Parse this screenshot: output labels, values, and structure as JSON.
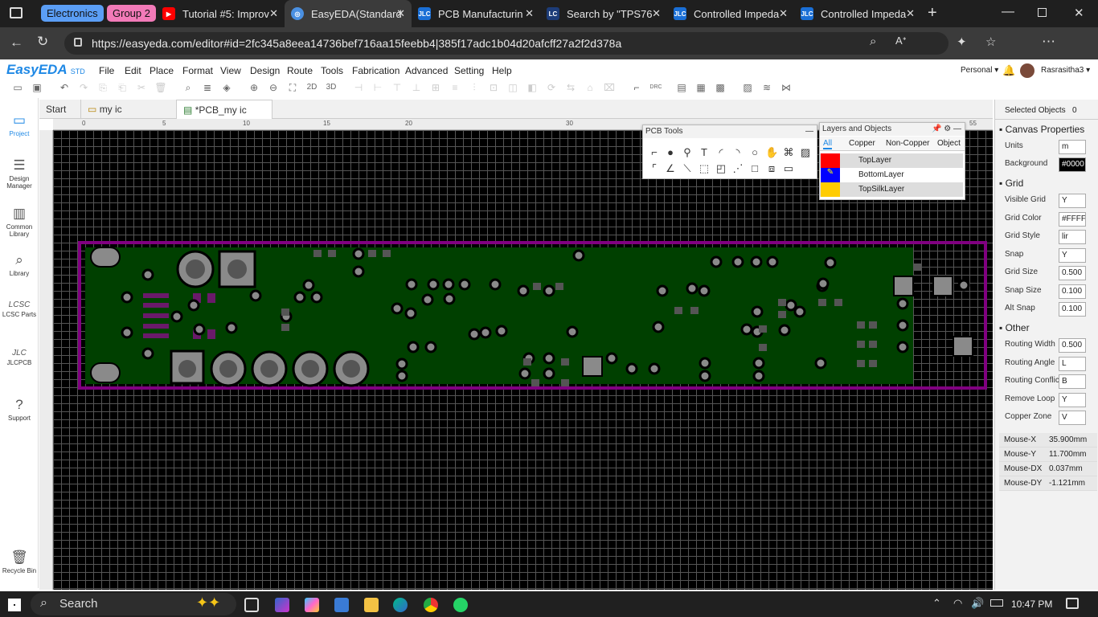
{
  "browser": {
    "tab_groups": [
      {
        "label": "Electronics",
        "color": "#5b9ef5"
      },
      {
        "label": "Group 2",
        "color": "#f27ab8"
      }
    ],
    "tabs": [
      {
        "title": "Tutorial #5: Improv",
        "icon": "youtube-icon",
        "active": false
      },
      {
        "title": "EasyEDA(Standard",
        "icon": "easyeda-icon",
        "active": true
      },
      {
        "title": "PCB Manufacturin",
        "icon": "jlc-icon",
        "active": false
      },
      {
        "title": "Search by \"TPS76",
        "icon": "lcsc-icon",
        "active": false
      },
      {
        "title": "Controlled Impeda",
        "icon": "jlc-icon",
        "active": false
      },
      {
        "title": "Controlled Impeda",
        "icon": "jlc-icon",
        "active": false
      }
    ],
    "url": "https://easyeda.com/editor#id=2fc345a8eea14736bef716aa15feebb4|385f17adc1b04d20afcff27a2f2d378a"
  },
  "app": {
    "logo": "EasyEDA",
    "logo_suffix": "STD",
    "menu": [
      "File",
      "Edit",
      "Place",
      "Format",
      "View",
      "Design",
      "Route",
      "Tools",
      "Fabrication",
      "Advanced",
      "Setting",
      "Help"
    ],
    "account": "Personal",
    "user": "Rasrasitha3",
    "toolbar_labels": {
      "two_d": "2D",
      "three_d": "3D",
      "drc": "DRC"
    }
  },
  "sidebar": [
    {
      "label": "Project",
      "icon": "folder-icon"
    },
    {
      "label": "Design Manager",
      "icon": "list-icon"
    },
    {
      "label": "Common Library",
      "icon": "chip-icon"
    },
    {
      "label": "Library",
      "icon": "search-icon"
    },
    {
      "label": "LCSC Parts",
      "icon": "lcsc-icon"
    },
    {
      "label": "JLCPCB",
      "icon": "jlc-icon"
    },
    {
      "label": "Support",
      "icon": "help-icon"
    },
    {
      "label": "Recycle Bin",
      "icon": "trash-icon"
    }
  ],
  "doc_tabs": [
    {
      "label": "Start"
    },
    {
      "label": "my ic"
    },
    {
      "label": "*PCB_my ic"
    }
  ],
  "ruler_ticks": [
    "0",
    "5",
    "10",
    "15",
    "20",
    "30",
    "55"
  ],
  "pcb_tools": {
    "title": "PCB Tools"
  },
  "layers": {
    "title": "Layers and Objects",
    "tabs": [
      "All",
      "Copper",
      "Non-Copper",
      "Object"
    ],
    "items": [
      {
        "name": "TopLayer",
        "color": "#ff0000"
      },
      {
        "name": "BottomLayer",
        "color": "#0000ff"
      },
      {
        "name": "TopSilkLayer",
        "color": "#ffcc00"
      }
    ]
  },
  "properties": {
    "selected_label": "Selected Objects",
    "selected_count": "0",
    "canvas_title": "Canvas Properties",
    "units_label": "Units",
    "units_value": "m",
    "background_label": "Background",
    "background_value": "#0000",
    "grid_title": "Grid",
    "visible_grid_label": "Visible Grid",
    "visible_grid_value": "Y",
    "grid_color_label": "Grid Color",
    "grid_color_value": "#FFFF",
    "grid_style_label": "Grid Style",
    "grid_style_value": "lir",
    "snap_label": "Snap",
    "snap_value": "Y",
    "grid_size_label": "Grid Size",
    "grid_size_value": "0.500",
    "snap_size_label": "Snap Size",
    "snap_size_value": "0.100",
    "alt_snap_label": "Alt Snap",
    "alt_snap_value": "0.100",
    "other_title": "Other",
    "routing_width_label": "Routing Width",
    "routing_width_value": "0.500",
    "routing_angle_label": "Routing Angle",
    "routing_angle_value": "L",
    "routing_conflict_label": "Routing Conflict",
    "routing_conflict_value": "B",
    "remove_loop_label": "Remove Loop",
    "remove_loop_value": "Y",
    "copper_zone_label": "Copper Zone",
    "copper_zone_value": "V",
    "mouse": [
      {
        "label": "Mouse-X",
        "value": "35.900mm"
      },
      {
        "label": "Mouse-Y",
        "value": "11.700mm"
      },
      {
        "label": "Mouse-DX",
        "value": "0.037mm"
      },
      {
        "label": "Mouse-DY",
        "value": "-1.121mm"
      }
    ]
  },
  "taskbar": {
    "search": "Search",
    "time": "10:47 PM"
  },
  "colors": {
    "board_fill": "#004000",
    "board_outline": "#800080",
    "pad": "#8a8a8a"
  }
}
